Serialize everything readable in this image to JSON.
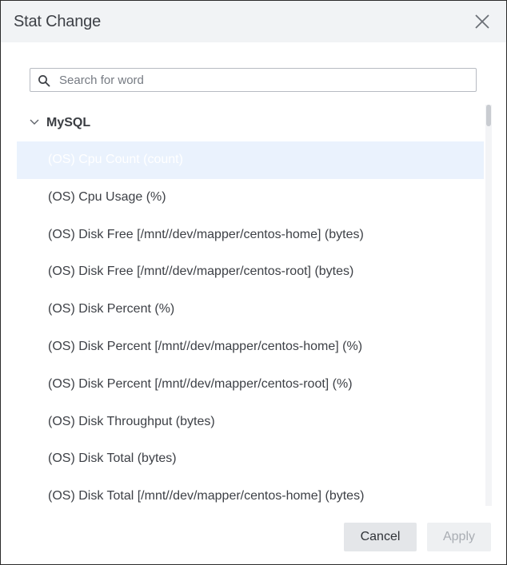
{
  "dialog": {
    "title": "Stat Change",
    "close_icon": "close-icon"
  },
  "search": {
    "icon": "search-icon",
    "placeholder": "Search for word",
    "value": ""
  },
  "tree": {
    "group": {
      "label": "MySQL",
      "expanded": true,
      "icon": "chevron-down-icon"
    },
    "items": [
      {
        "label": "(OS) Cpu Count (count)",
        "selected": true
      },
      {
        "label": "(OS) Cpu Usage (%)"
      },
      {
        "label": "(OS) Disk Free [/mnt//dev/mapper/centos-home] (bytes)"
      },
      {
        "label": "(OS) Disk Free [/mnt//dev/mapper/centos-root] (bytes)"
      },
      {
        "label": "(OS) Disk Percent (%)"
      },
      {
        "label": "(OS) Disk Percent [/mnt//dev/mapper/centos-home] (%)"
      },
      {
        "label": "(OS) Disk Percent [/mnt//dev/mapper/centos-root] (%)"
      },
      {
        "label": "(OS) Disk Throughput (bytes)"
      },
      {
        "label": "(OS) Disk Total (bytes)"
      },
      {
        "label": "(OS) Disk Total [/mnt//dev/mapper/centos-home] (bytes)"
      }
    ]
  },
  "footer": {
    "cancel_label": "Cancel",
    "apply_label": "Apply",
    "apply_enabled": false
  },
  "colors": {
    "header_bg": "#f1f3f5",
    "selected_row_bg": "#eaf2fd",
    "text": "#3d4046"
  }
}
